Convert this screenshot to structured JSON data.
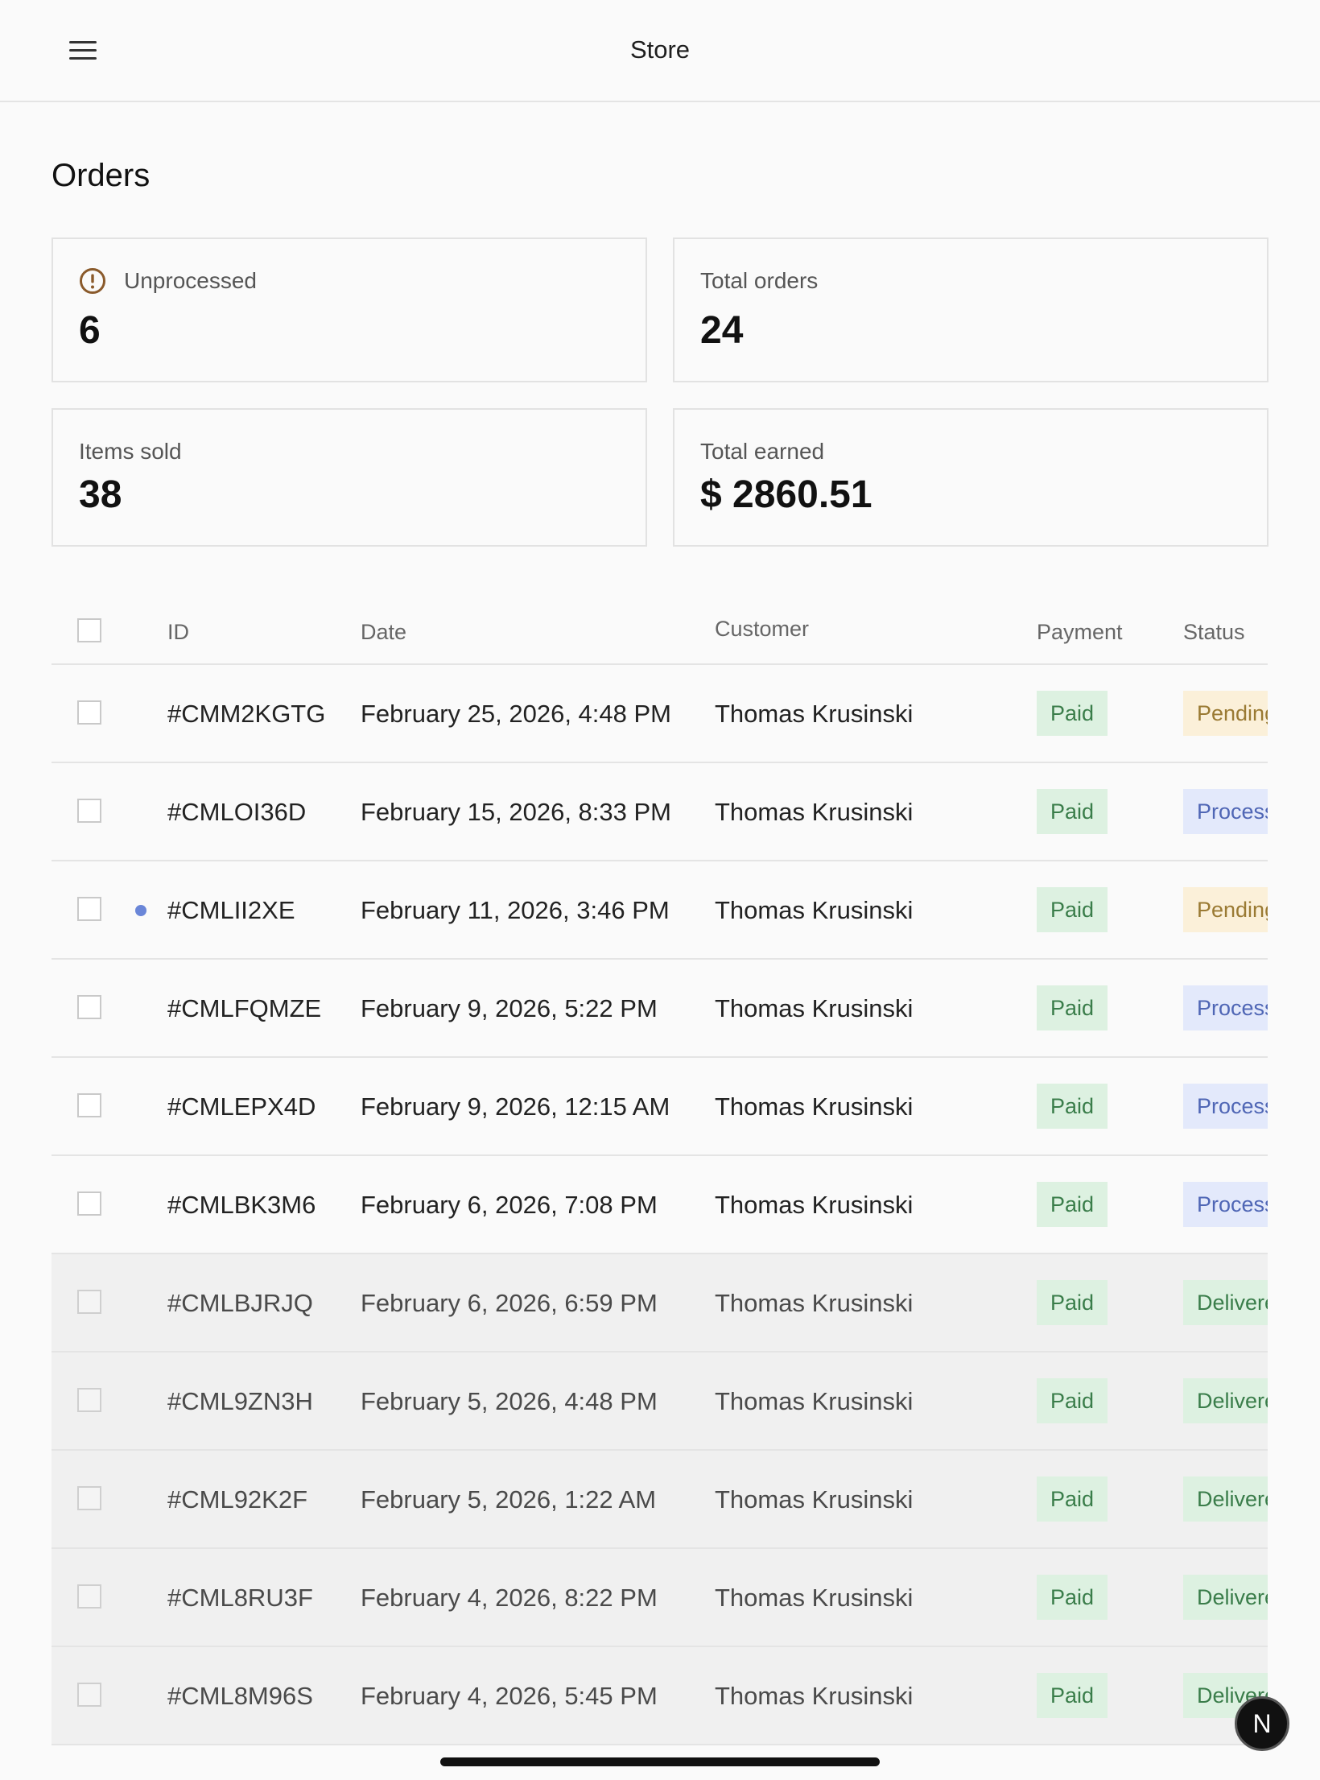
{
  "header": {
    "title": "Store",
    "menu_icon": "hamburger-menu-icon"
  },
  "page": {
    "title": "Orders"
  },
  "stats": {
    "unprocessed": {
      "label": "Unprocessed",
      "value": "6",
      "icon": "alert-circle-icon"
    },
    "total_orders": {
      "label": "Total orders",
      "value": "24"
    },
    "items_sold": {
      "label": "Items sold",
      "value": "38"
    },
    "total_earned": {
      "label": "Total earned",
      "value": "$ 2860.51"
    }
  },
  "table": {
    "columns": {
      "id": "ID",
      "date": "Date",
      "customer": "Customer",
      "payment": "Payment",
      "status": "Status"
    },
    "rows": [
      {
        "id": "#CMM2KGTG",
        "date": "February 25, 2026, 4:48 PM",
        "customer": "Thomas Krusinski",
        "payment": "Paid",
        "status": "Pending",
        "status_type": "pending",
        "unread": false,
        "muted": false
      },
      {
        "id": "#CMLOI36D",
        "date": "February 15, 2026, 8:33 PM",
        "customer": "Thomas Krusinski",
        "payment": "Paid",
        "status": "Processing",
        "status_type": "processing",
        "unread": false,
        "muted": false
      },
      {
        "id": "#CMLII2XE",
        "date": "February 11, 2026, 3:46 PM",
        "customer": "Thomas Krusinski",
        "payment": "Paid",
        "status": "Pending",
        "status_type": "pending",
        "unread": true,
        "muted": false
      },
      {
        "id": "#CMLFQMZE",
        "date": "February 9, 2026, 5:22 PM",
        "customer": "Thomas Krusinski",
        "payment": "Paid",
        "status": "Processing",
        "status_type": "processing",
        "unread": false,
        "muted": false
      },
      {
        "id": "#CMLEPX4D",
        "date": "February 9, 2026, 12:15 AM",
        "customer": "Thomas Krusinski",
        "payment": "Paid",
        "status": "Processing",
        "status_type": "processing",
        "unread": false,
        "muted": false
      },
      {
        "id": "#CMLBK3M6",
        "date": "February 6, 2026, 7:08 PM",
        "customer": "Thomas Krusinski",
        "payment": "Paid",
        "status": "Processing",
        "status_type": "processing",
        "unread": false,
        "muted": false
      },
      {
        "id": "#CMLBJRJQ",
        "date": "February 6, 2026, 6:59 PM",
        "customer": "Thomas Krusinski",
        "payment": "Paid",
        "status": "Delivered",
        "status_type": "delivered",
        "unread": false,
        "muted": true
      },
      {
        "id": "#CML9ZN3H",
        "date": "February 5, 2026, 4:48 PM",
        "customer": "Thomas Krusinski",
        "payment": "Paid",
        "status": "Delivered",
        "status_type": "delivered",
        "unread": false,
        "muted": true
      },
      {
        "id": "#CML92K2F",
        "date": "February 5, 2026, 1:22 AM",
        "customer": "Thomas Krusinski",
        "payment": "Paid",
        "status": "Delivered",
        "status_type": "delivered",
        "unread": false,
        "muted": true
      },
      {
        "id": "#CML8RU3F",
        "date": "February 4, 2026, 8:22 PM",
        "customer": "Thomas Krusinski",
        "payment": "Paid",
        "status": "Delivered",
        "status_type": "delivered",
        "unread": false,
        "muted": true
      },
      {
        "id": "#CML8M96S",
        "date": "February 4, 2026, 5:45 PM",
        "customer": "Thomas Krusinski",
        "payment": "Paid",
        "status": "Delivered",
        "status_type": "delivered",
        "unread": false,
        "muted": true
      }
    ]
  },
  "floating_badge": {
    "label": "N"
  },
  "colors": {
    "paid_bg": "#ddf1e1",
    "paid_text": "#3a7d4a",
    "pending_bg": "#fbf0d9",
    "pending_text": "#9a7a33",
    "processing_bg": "#e3e9fb",
    "processing_text": "#4f66b5",
    "unread_dot": "#6a86d8",
    "warning_icon": "#8a5a2b"
  }
}
